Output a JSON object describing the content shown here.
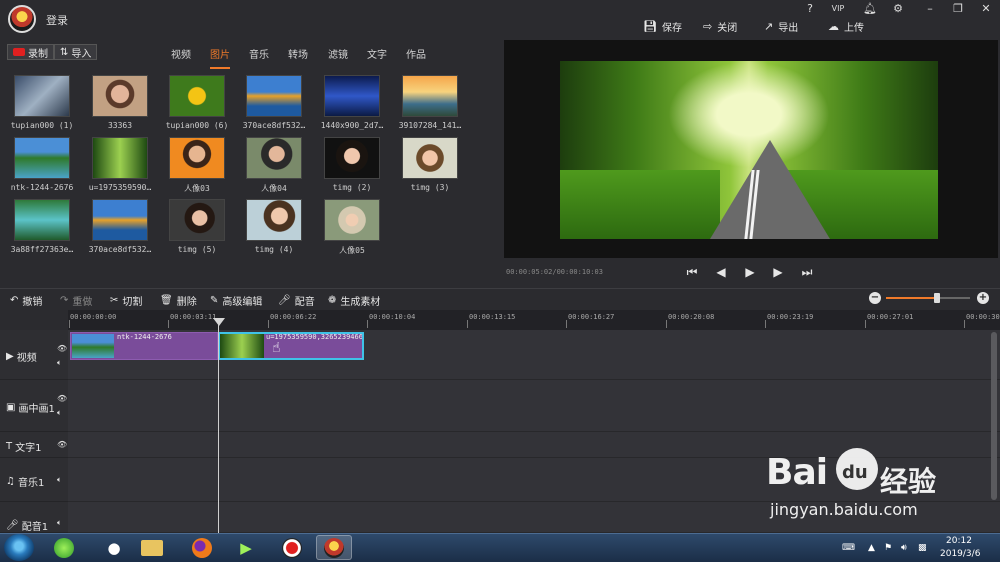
{
  "titlebar": {
    "login": "登录",
    "help": "?",
    "vip": "VIP",
    "actions": [
      {
        "icon": "save-icon",
        "label": "保存"
      },
      {
        "icon": "close-icon",
        "label": "关闭"
      },
      {
        "icon": "export-icon",
        "label": "导出"
      },
      {
        "icon": "upload-icon",
        "label": "上传"
      }
    ]
  },
  "library": {
    "record_label": "录制",
    "import_label": "导入",
    "tabs": [
      "视频",
      "图片",
      "音乐",
      "转场",
      "滤镜",
      "文字",
      "作品"
    ],
    "active_tab": "图片",
    "thumbs": [
      {
        "label": "tupian000 (1)"
      },
      {
        "label": "33363"
      },
      {
        "label": "tupian000 (6)"
      },
      {
        "label": "370ace8df532…"
      },
      {
        "label": "1440x900_2d7…"
      },
      {
        "label": "39107284_141…"
      },
      {
        "label": "ntk-1244-2676"
      },
      {
        "label": "u=1975359590…"
      },
      {
        "label": "人像03"
      },
      {
        "label": "人像04"
      },
      {
        "label": "timg (2)"
      },
      {
        "label": "timg (3)"
      },
      {
        "label": "3a88ff27363e…"
      },
      {
        "label": "370ace8df532…"
      },
      {
        "label": "timg (5)"
      },
      {
        "label": "timg (4)"
      },
      {
        "label": "人像05"
      }
    ]
  },
  "preview": {
    "time": "00:00:05:02/00:00:10:03"
  },
  "toolbar": {
    "undo": "撤销",
    "redo": "重做",
    "cut": "切割",
    "delete": "删除",
    "advanced": "高级编辑",
    "dub": "配音",
    "generate": "生成素材"
  },
  "ruler": {
    "ticks": [
      "00:00:00:00",
      "00:00:03:11",
      "00:00:06:22",
      "00:00:10:04",
      "00:00:13:15",
      "00:00:16:27",
      "00:00:20:08",
      "00:00:23:19",
      "00:00:27:01",
      "00:00:30:"
    ]
  },
  "tracks": {
    "video": "视频",
    "pip": "画中画1",
    "text": "文字1",
    "music": "音乐1",
    "voice": "配音1"
  },
  "clips": {
    "clip1": "ntk-1244-2676",
    "clip2": "u=1975359590,3265239466"
  },
  "taskbar": {
    "time": "20:12",
    "date": "2019/3/6"
  },
  "watermark": {
    "logo": "Bai",
    "logo2": "du",
    "cn": "经验",
    "url": "jingyan.baidu.com"
  },
  "colors": {
    "accent": "#f07a2a",
    "clip": "#7a4c9a",
    "selected_clip_border": "#3fc3e8"
  }
}
